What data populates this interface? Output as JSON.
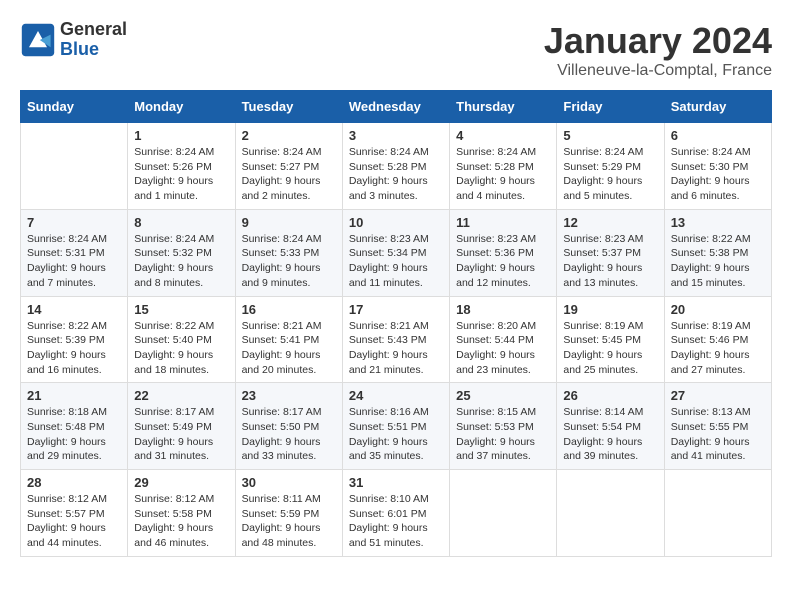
{
  "header": {
    "logo_general": "General",
    "logo_blue": "Blue",
    "month_year": "January 2024",
    "location": "Villeneuve-la-Comptal, France"
  },
  "weekdays": [
    "Sunday",
    "Monday",
    "Tuesday",
    "Wednesday",
    "Thursday",
    "Friday",
    "Saturday"
  ],
  "weeks": [
    [
      {
        "day": "",
        "sunrise": "",
        "sunset": "",
        "daylight": ""
      },
      {
        "day": "1",
        "sunrise": "Sunrise: 8:24 AM",
        "sunset": "Sunset: 5:26 PM",
        "daylight": "Daylight: 9 hours and 1 minute."
      },
      {
        "day": "2",
        "sunrise": "Sunrise: 8:24 AM",
        "sunset": "Sunset: 5:27 PM",
        "daylight": "Daylight: 9 hours and 2 minutes."
      },
      {
        "day": "3",
        "sunrise": "Sunrise: 8:24 AM",
        "sunset": "Sunset: 5:28 PM",
        "daylight": "Daylight: 9 hours and 3 minutes."
      },
      {
        "day": "4",
        "sunrise": "Sunrise: 8:24 AM",
        "sunset": "Sunset: 5:28 PM",
        "daylight": "Daylight: 9 hours and 4 minutes."
      },
      {
        "day": "5",
        "sunrise": "Sunrise: 8:24 AM",
        "sunset": "Sunset: 5:29 PM",
        "daylight": "Daylight: 9 hours and 5 minutes."
      },
      {
        "day": "6",
        "sunrise": "Sunrise: 8:24 AM",
        "sunset": "Sunset: 5:30 PM",
        "daylight": "Daylight: 9 hours and 6 minutes."
      }
    ],
    [
      {
        "day": "7",
        "sunrise": "Sunrise: 8:24 AM",
        "sunset": "Sunset: 5:31 PM",
        "daylight": "Daylight: 9 hours and 7 minutes."
      },
      {
        "day": "8",
        "sunrise": "Sunrise: 8:24 AM",
        "sunset": "Sunset: 5:32 PM",
        "daylight": "Daylight: 9 hours and 8 minutes."
      },
      {
        "day": "9",
        "sunrise": "Sunrise: 8:24 AM",
        "sunset": "Sunset: 5:33 PM",
        "daylight": "Daylight: 9 hours and 9 minutes."
      },
      {
        "day": "10",
        "sunrise": "Sunrise: 8:23 AM",
        "sunset": "Sunset: 5:34 PM",
        "daylight": "Daylight: 9 hours and 11 minutes."
      },
      {
        "day": "11",
        "sunrise": "Sunrise: 8:23 AM",
        "sunset": "Sunset: 5:36 PM",
        "daylight": "Daylight: 9 hours and 12 minutes."
      },
      {
        "day": "12",
        "sunrise": "Sunrise: 8:23 AM",
        "sunset": "Sunset: 5:37 PM",
        "daylight": "Daylight: 9 hours and 13 minutes."
      },
      {
        "day": "13",
        "sunrise": "Sunrise: 8:22 AM",
        "sunset": "Sunset: 5:38 PM",
        "daylight": "Daylight: 9 hours and 15 minutes."
      }
    ],
    [
      {
        "day": "14",
        "sunrise": "Sunrise: 8:22 AM",
        "sunset": "Sunset: 5:39 PM",
        "daylight": "Daylight: 9 hours and 16 minutes."
      },
      {
        "day": "15",
        "sunrise": "Sunrise: 8:22 AM",
        "sunset": "Sunset: 5:40 PM",
        "daylight": "Daylight: 9 hours and 18 minutes."
      },
      {
        "day": "16",
        "sunrise": "Sunrise: 8:21 AM",
        "sunset": "Sunset: 5:41 PM",
        "daylight": "Daylight: 9 hours and 20 minutes."
      },
      {
        "day": "17",
        "sunrise": "Sunrise: 8:21 AM",
        "sunset": "Sunset: 5:43 PM",
        "daylight": "Daylight: 9 hours and 21 minutes."
      },
      {
        "day": "18",
        "sunrise": "Sunrise: 8:20 AM",
        "sunset": "Sunset: 5:44 PM",
        "daylight": "Daylight: 9 hours and 23 minutes."
      },
      {
        "day": "19",
        "sunrise": "Sunrise: 8:19 AM",
        "sunset": "Sunset: 5:45 PM",
        "daylight": "Daylight: 9 hours and 25 minutes."
      },
      {
        "day": "20",
        "sunrise": "Sunrise: 8:19 AM",
        "sunset": "Sunset: 5:46 PM",
        "daylight": "Daylight: 9 hours and 27 minutes."
      }
    ],
    [
      {
        "day": "21",
        "sunrise": "Sunrise: 8:18 AM",
        "sunset": "Sunset: 5:48 PM",
        "daylight": "Daylight: 9 hours and 29 minutes."
      },
      {
        "day": "22",
        "sunrise": "Sunrise: 8:17 AM",
        "sunset": "Sunset: 5:49 PM",
        "daylight": "Daylight: 9 hours and 31 minutes."
      },
      {
        "day": "23",
        "sunrise": "Sunrise: 8:17 AM",
        "sunset": "Sunset: 5:50 PM",
        "daylight": "Daylight: 9 hours and 33 minutes."
      },
      {
        "day": "24",
        "sunrise": "Sunrise: 8:16 AM",
        "sunset": "Sunset: 5:51 PM",
        "daylight": "Daylight: 9 hours and 35 minutes."
      },
      {
        "day": "25",
        "sunrise": "Sunrise: 8:15 AM",
        "sunset": "Sunset: 5:53 PM",
        "daylight": "Daylight: 9 hours and 37 minutes."
      },
      {
        "day": "26",
        "sunrise": "Sunrise: 8:14 AM",
        "sunset": "Sunset: 5:54 PM",
        "daylight": "Daylight: 9 hours and 39 minutes."
      },
      {
        "day": "27",
        "sunrise": "Sunrise: 8:13 AM",
        "sunset": "Sunset: 5:55 PM",
        "daylight": "Daylight: 9 hours and 41 minutes."
      }
    ],
    [
      {
        "day": "28",
        "sunrise": "Sunrise: 8:12 AM",
        "sunset": "Sunset: 5:57 PM",
        "daylight": "Daylight: 9 hours and 44 minutes."
      },
      {
        "day": "29",
        "sunrise": "Sunrise: 8:12 AM",
        "sunset": "Sunset: 5:58 PM",
        "daylight": "Daylight: 9 hours and 46 minutes."
      },
      {
        "day": "30",
        "sunrise": "Sunrise: 8:11 AM",
        "sunset": "Sunset: 5:59 PM",
        "daylight": "Daylight: 9 hours and 48 minutes."
      },
      {
        "day": "31",
        "sunrise": "Sunrise: 8:10 AM",
        "sunset": "Sunset: 6:01 PM",
        "daylight": "Daylight: 9 hours and 51 minutes."
      },
      {
        "day": "",
        "sunrise": "",
        "sunset": "",
        "daylight": ""
      },
      {
        "day": "",
        "sunrise": "",
        "sunset": "",
        "daylight": ""
      },
      {
        "day": "",
        "sunrise": "",
        "sunset": "",
        "daylight": ""
      }
    ]
  ]
}
